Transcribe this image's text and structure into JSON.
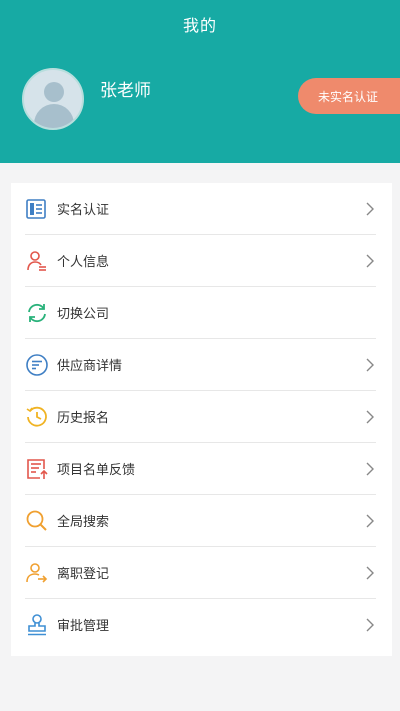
{
  "header": {
    "title": "我的"
  },
  "profile": {
    "name": "张老师",
    "verify_badge": "未实名认证"
  },
  "menu": [
    {
      "label": "实名认证",
      "icon": "id-card-icon",
      "color": "#3f7fc4",
      "chevron": true
    },
    {
      "label": "个人信息",
      "icon": "person-info-icon",
      "color": "#e2574c",
      "chevron": true
    },
    {
      "label": "切换公司",
      "icon": "switch-refresh-icon",
      "color": "#2ab27b",
      "chevron": false
    },
    {
      "label": "供应商详情",
      "icon": "list-detail-icon",
      "color": "#3f7fc4",
      "chevron": true
    },
    {
      "label": "历史报名",
      "icon": "history-clock-icon",
      "color": "#f0b323",
      "chevron": true
    },
    {
      "label": "项目名单反馈",
      "icon": "feedback-doc-icon",
      "color": "#e2574c",
      "chevron": true
    },
    {
      "label": "全局搜索",
      "icon": "search-icon",
      "color": "#f0a030",
      "chevron": true
    },
    {
      "label": "离职登记",
      "icon": "leave-user-icon",
      "color": "#f0a030",
      "chevron": true
    },
    {
      "label": "审批管理",
      "icon": "approval-stamp-icon",
      "color": "#3f8fd4",
      "chevron": true
    }
  ]
}
